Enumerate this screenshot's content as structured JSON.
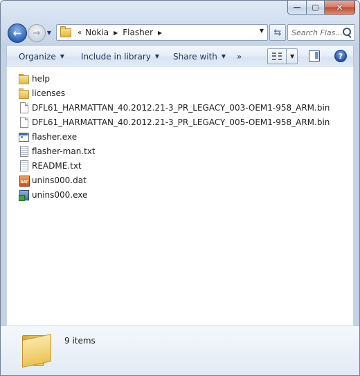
{
  "window": {
    "caption": {
      "minimize": "—",
      "maximize": "▢",
      "close": "✕"
    }
  },
  "nav": {
    "breadcrumb_overflow": "«",
    "breadcrumb": [
      "Nokia",
      "Flasher"
    ],
    "search_placeholder": "Search Flas..."
  },
  "commandbar": {
    "organize": "Organize",
    "include": "Include in library",
    "share": "Share with",
    "more": "»",
    "help": "?"
  },
  "files": [
    {
      "name": "help",
      "icon": "folder-icon"
    },
    {
      "name": "licenses",
      "icon": "folder-icon"
    },
    {
      "name": "DFL61_HARMATTAN_40.2012.21-3_PR_LEGACY_003-OEM1-958_ARM.bin",
      "icon": "file-icon"
    },
    {
      "name": "DFL61_HARMATTAN_40.2012.21-3_PR_LEGACY_005-OEM1-958_ARM.bin",
      "icon": "file-icon"
    },
    {
      "name": "flasher.exe",
      "icon": "exe-icon"
    },
    {
      "name": "flasher-man.txt",
      "icon": "text-file-icon"
    },
    {
      "name": "README.txt",
      "icon": "text-file-icon"
    },
    {
      "name": "unins000.dat",
      "icon": "dat-file-icon",
      "badge": "DAT"
    },
    {
      "name": "unins000.exe",
      "icon": "installer-icon"
    }
  ],
  "details": {
    "count": "9 items"
  }
}
